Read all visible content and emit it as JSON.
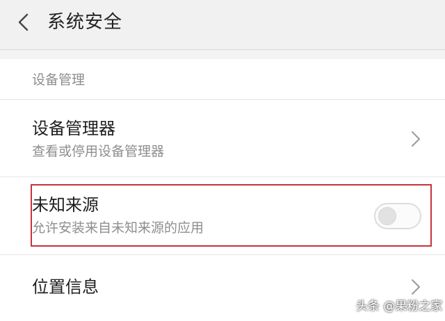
{
  "header": {
    "title": "系统安全",
    "back_icon": "chevron-left-icon"
  },
  "section": {
    "label": "设备管理"
  },
  "items": [
    {
      "title": "设备管理器",
      "subtitle": "查看或停用设备管理器",
      "control": "chevron-right-icon"
    },
    {
      "title": "未知来源",
      "subtitle": "允许安装来自未知来源的应用",
      "control": "toggle",
      "toggle_state": "off"
    },
    {
      "title": "位置信息",
      "control": "chevron-right-icon"
    }
  ],
  "watermark": "头条 @果粉之家",
  "colors": {
    "highlight": "#c8323c",
    "primary_text": "#1e1e1e",
    "secondary_text": "#8e8e8e",
    "header_bg": "#f1f1f1"
  }
}
